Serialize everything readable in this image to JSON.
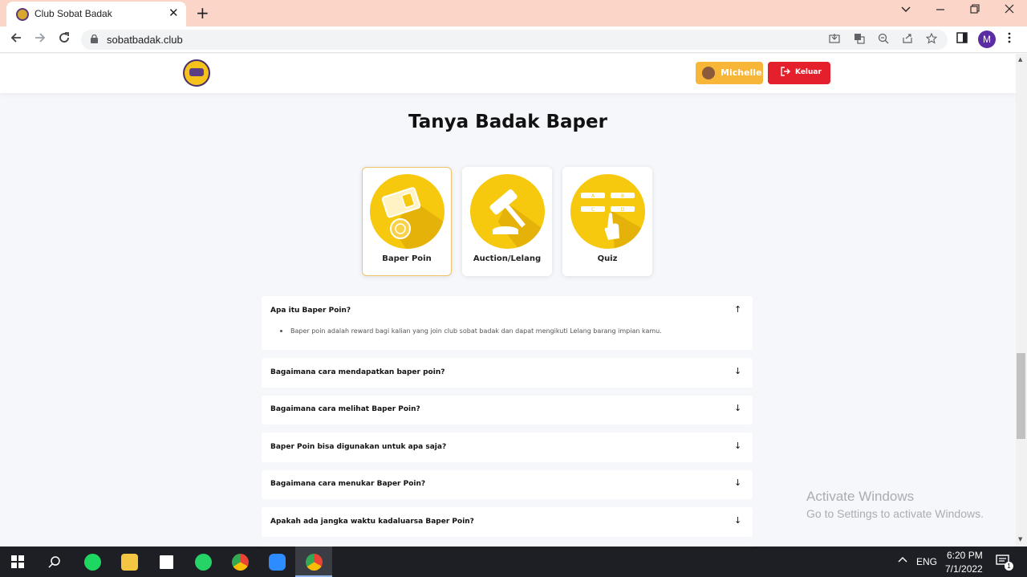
{
  "browser": {
    "tab_title": "Club Sobat Badak",
    "tab_close": "✕",
    "new_tab": "+",
    "url": "sobatbadak.club",
    "profile_initial": "M"
  },
  "header": {
    "user_name": "Michelle",
    "logout_label": "Keluar"
  },
  "page": {
    "title": "Tanya Badak Baper"
  },
  "categories": [
    {
      "label": "Baper Poin",
      "active": true
    },
    {
      "label": "Auction/Lelang",
      "active": false
    },
    {
      "label": "Quiz",
      "active": false
    }
  ],
  "quiz_letters": [
    "A",
    "B",
    "C",
    "D"
  ],
  "faq": [
    {
      "question": "Apa itu Baper Poin?",
      "expanded": true,
      "answer": "Baper poin adalah reward bagi kalian yang join club sobat badak dan dapat mengikuti Lelang barang impian kamu.",
      "arrow": "↑"
    },
    {
      "question": "Bagaimana cara mendapatkan baper poin?",
      "expanded": false,
      "arrow": "↓"
    },
    {
      "question": "Bagaimana cara melihat Baper Poin?",
      "expanded": false,
      "arrow": "↓"
    },
    {
      "question": "Baper Poin bisa digunakan untuk apa saja?",
      "expanded": false,
      "arrow": "↓"
    },
    {
      "question": "Bagaimana cara menukar Baper Poin?",
      "expanded": false,
      "arrow": "↓"
    },
    {
      "question": "Apakah ada jangka waktu kadaluarsa Baper Poin?",
      "expanded": false,
      "arrow": "↓"
    }
  ],
  "watermark": {
    "line1": "Activate Windows",
    "line2": "Go to Settings to activate Windows."
  },
  "taskbar": {
    "language": "ENG",
    "time": "6:20 PM",
    "date": "7/1/2022",
    "notification_count": "1"
  },
  "colors": {
    "accent_yellow": "#f6c90e",
    "user_button": "#f7b638",
    "logout_button": "#e4202d"
  }
}
